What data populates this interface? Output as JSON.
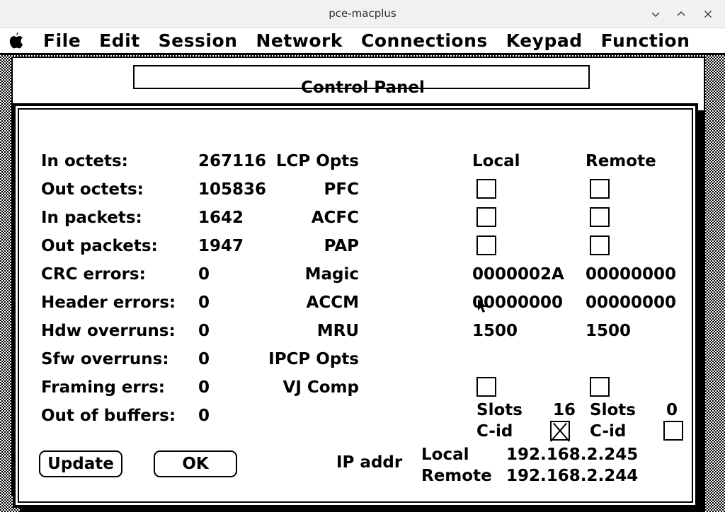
{
  "host_window": {
    "title": "pce-macplus",
    "buttons": [
      {
        "name": "minimize",
        "glyph": "chevron-down"
      },
      {
        "name": "maximize",
        "glyph": "chevron-up"
      },
      {
        "name": "close",
        "glyph": "x"
      }
    ]
  },
  "menubar": {
    "apple_icon": "apple-icon",
    "items": [
      {
        "label": "File"
      },
      {
        "label": "Edit"
      },
      {
        "label": "Session"
      },
      {
        "label": "Network"
      },
      {
        "label": "Connections"
      },
      {
        "label": "Keypad"
      },
      {
        "label": "Function"
      }
    ]
  },
  "background_window": {
    "title": "Control Panel"
  },
  "dialog": {
    "stats": [
      {
        "label": "In octets:",
        "value": "267116"
      },
      {
        "label": "Out octets:",
        "value": "105836"
      },
      {
        "label": "In packets:",
        "value": "1642"
      },
      {
        "label": "Out packets:",
        "value": "1947"
      },
      {
        "label": "CRC errors:",
        "value": "0"
      },
      {
        "label": "Header errors:",
        "value": "0"
      },
      {
        "label": "Hdw overruns:",
        "value": "0"
      },
      {
        "label": "Sfw overruns:",
        "value": "0"
      },
      {
        "label": "Framing errs:",
        "value": "0"
      },
      {
        "label": "Out of buffers:",
        "value": "0"
      }
    ],
    "buttons": {
      "update": "Update",
      "ok": "OK"
    },
    "columns": {
      "local": "Local",
      "remote": "Remote"
    },
    "lcp": {
      "heading": "LCP Opts",
      "checkbox_rows": [
        {
          "label": "PFC",
          "local_checked": false,
          "remote_checked": false
        },
        {
          "label": "ACFC",
          "local_checked": false,
          "remote_checked": false
        },
        {
          "label": "PAP",
          "local_checked": false,
          "remote_checked": false
        }
      ],
      "value_rows": [
        {
          "label": "Magic",
          "local": "0000002A",
          "remote": "00000000"
        },
        {
          "label": "ACCM",
          "local": "00000000",
          "remote": "00000000"
        },
        {
          "label": "MRU",
          "local": "1500",
          "remote": "1500"
        }
      ]
    },
    "ipcp": {
      "heading": "IPCP Opts",
      "vj_comp": {
        "label": "VJ Comp",
        "local_checked": false,
        "remote_checked": false
      },
      "slots": {
        "label_local": "Slots",
        "local": "16",
        "label_remote": "Slots",
        "remote": "0"
      },
      "cid": {
        "label_local": "C-id",
        "local_checked": true,
        "label_remote": "C-id",
        "remote_checked": false
      }
    },
    "ip_addr": {
      "heading": "IP addr",
      "local_label": "Local",
      "local_value": "192.168.2.245",
      "remote_label": "Remote",
      "remote_value": "192.168.2.244"
    }
  },
  "colors": {
    "ink": "#000000",
    "paper": "#ffffff",
    "chrome": "#f1f1f1"
  }
}
